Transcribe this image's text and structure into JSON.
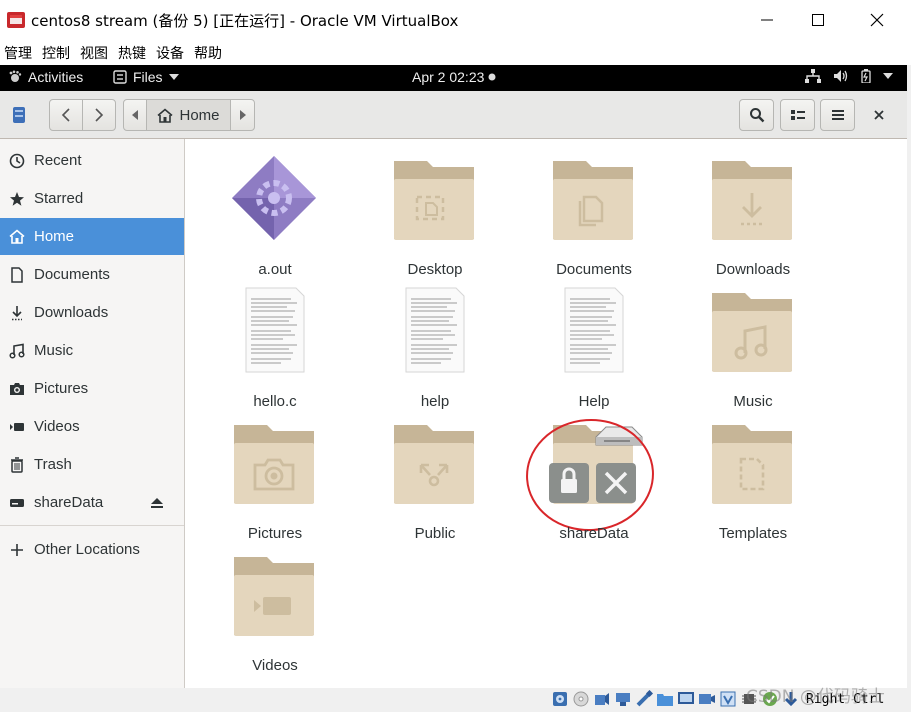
{
  "window": {
    "title": "centos8 stream (备份 5) [正在运行] - Oracle VM VirtualBox"
  },
  "host_menu": [
    "管理",
    "控制",
    "视图",
    "热键",
    "设备",
    "帮助"
  ],
  "gnome": {
    "activities": "Activities",
    "app_menu": "Files",
    "clock": "Apr 2  02:23"
  },
  "path": {
    "current": "Home"
  },
  "sidebar": {
    "items": [
      {
        "label": "Recent",
        "icon": "clock-icon"
      },
      {
        "label": "Starred",
        "icon": "star-icon"
      },
      {
        "label": "Home",
        "icon": "home-icon",
        "active": true
      },
      {
        "label": "Documents",
        "icon": "document-icon"
      },
      {
        "label": "Downloads",
        "icon": "download-icon"
      },
      {
        "label": "Music",
        "icon": "music-icon"
      },
      {
        "label": "Pictures",
        "icon": "camera-icon"
      },
      {
        "label": "Videos",
        "icon": "video-icon"
      },
      {
        "label": "Trash",
        "icon": "trash-icon"
      },
      {
        "label": "shareData",
        "icon": "drive-icon"
      }
    ],
    "other_locations": "Other Locations"
  },
  "files": [
    {
      "name": "a.out",
      "type": "executable"
    },
    {
      "name": "Desktop",
      "type": "folder"
    },
    {
      "name": "Documents",
      "type": "folder"
    },
    {
      "name": "Downloads",
      "type": "folder"
    },
    {
      "name": "hello.c",
      "type": "text"
    },
    {
      "name": "help",
      "type": "text"
    },
    {
      "name": "Help",
      "type": "text"
    },
    {
      "name": "Music",
      "type": "folder"
    },
    {
      "name": "Pictures",
      "type": "folder"
    },
    {
      "name": "Public",
      "type": "folder"
    },
    {
      "name": "shareData",
      "type": "mount"
    },
    {
      "name": "Templates",
      "type": "folder"
    },
    {
      "name": "Videos",
      "type": "folder"
    }
  ],
  "status": {
    "host_key": "Right Ctrl"
  },
  "watermark": "CSDN @代码骑士",
  "colors": {
    "accent": "#4a90d9",
    "folder": "#d8c9ae",
    "annotation": "#d9262a"
  }
}
